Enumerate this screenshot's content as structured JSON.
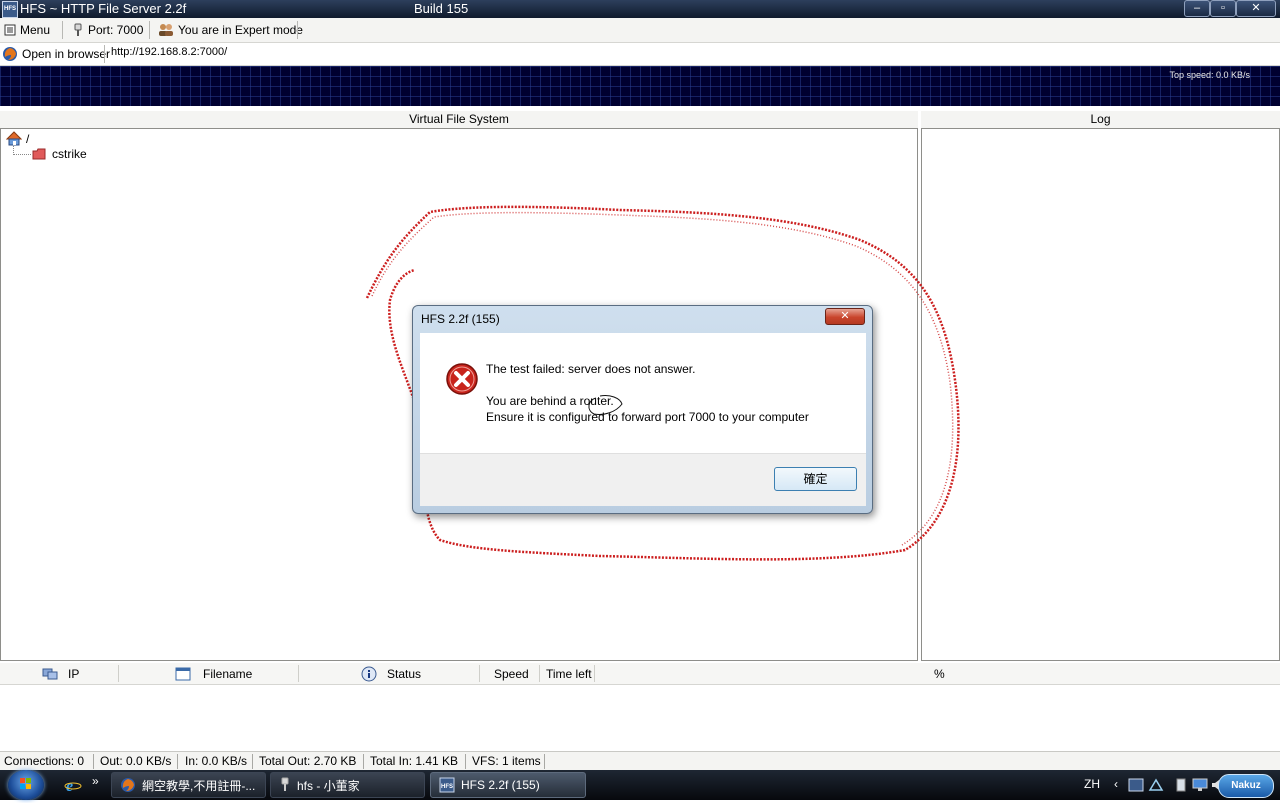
{
  "window": {
    "app_icon_text": "HFS",
    "title": "HFS ~ HTTP File Server 2.2f",
    "build": "Build 155",
    "controls": {
      "minimize": "–",
      "maximize": "▫",
      "close": "✕"
    }
  },
  "toolbar": {
    "menu_label": "Menu",
    "port_label": "Port: 7000",
    "mode_label": "You are in Expert mode"
  },
  "urlbar": {
    "open_label": "Open in browser",
    "url": "http://192.168.8.2:7000/"
  },
  "graph": {
    "top_speed": "Top speed: 0.0 KB/s"
  },
  "vfs": {
    "header": "Virtual File System",
    "root": "/",
    "items": [
      {
        "label": "cstrike"
      }
    ]
  },
  "log": {
    "header": "Log"
  },
  "dialog": {
    "title": "HFS 2.2f (155)",
    "line1": "The test failed: server does not answer.",
    "line2": "You are behind a router.",
    "line3": "Ensure it is configured to forward port 7000 to your computer",
    "ok_label": "確定",
    "close_glyph": "✕"
  },
  "transfers": {
    "columns": [
      "IP",
      "Filename",
      "Status",
      "Speed",
      "Time left",
      "%"
    ]
  },
  "status": {
    "connections": "Connections: 0",
    "out": "Out: 0.0 KB/s",
    "in": "In: 0.0 KB/s",
    "total_out": "Total Out: 2.70 KB",
    "total_in": "Total In: 1.41 KB",
    "vfs": "VFS: 1 items"
  },
  "taskbar": {
    "chevron": "»",
    "tasks": [
      {
        "label": "網空教學,不用註冊-..."
      },
      {
        "label": "hfs - 小董家"
      },
      {
        "label": "HFS 2.2f (155)"
      }
    ],
    "language": "ZH",
    "tray_chevron": "‹",
    "nakuz_label": "Nakuz"
  },
  "colors": {
    "annotation_red": "#cc1f1f",
    "graph_bg": "#000030",
    "dialog_frame": "#c4d6e8"
  }
}
